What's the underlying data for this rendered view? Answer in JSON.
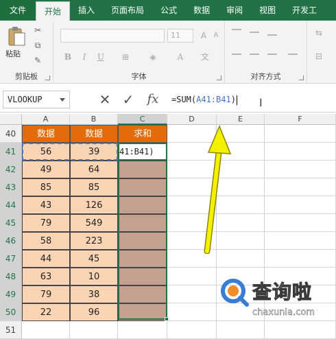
{
  "ribbon": {
    "tabs": [
      "文件",
      "开始",
      "插入",
      "页面布局",
      "公式",
      "数据",
      "审阅",
      "视图",
      "开发工"
    ],
    "active_tab": "开始",
    "groups": {
      "clipboard": "剪贴板",
      "font": "字体",
      "alignment": "对齐方式"
    },
    "paste_label": "粘贴",
    "font_size": "11"
  },
  "formula_bar": {
    "name_box": "VLOOKUP",
    "formula_prefix": "=SUM(",
    "formula_ref": "A41:B41",
    "formula_suffix": ")"
  },
  "columns": [
    "A",
    "B",
    "C",
    "D",
    "E",
    "F"
  ],
  "rows": [
    "40",
    "41",
    "42",
    "43",
    "44",
    "45",
    "46",
    "47",
    "48",
    "49",
    "50",
    "51"
  ],
  "table": {
    "headers": [
      "数据",
      "数据",
      "求和"
    ],
    "editing_text": "41:B41)",
    "rows": [
      [
        "56",
        "39"
      ],
      [
        "49",
        "64"
      ],
      [
        "85",
        "85"
      ],
      [
        "43",
        "126"
      ],
      [
        "79",
        "549"
      ],
      [
        "58",
        "223"
      ],
      [
        "44",
        "45"
      ],
      [
        "63",
        "10"
      ],
      [
        "79",
        "38"
      ],
      [
        "22",
        "96"
      ]
    ]
  },
  "watermark": {
    "text": "查询啦",
    "url": "chaxunla.com"
  },
  "colors": {
    "excel_green": "#217346",
    "header_orange": "#e26b0a",
    "data_peach": "#fbd4b4",
    "sum_brown": "#c4a090",
    "ref_blue": "#4472c4",
    "arrow_yellow": "#f5f000"
  }
}
